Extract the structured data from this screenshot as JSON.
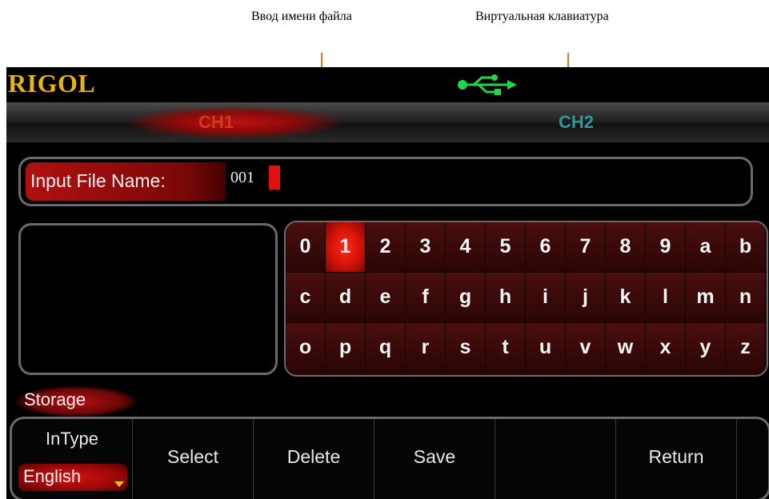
{
  "annotations": {
    "filename_input": "Ввод имени файла",
    "virtual_keyboard": "Виртуальная клавиатура"
  },
  "header": {
    "logo": "RIGOL",
    "usb_icon": "usb-icon",
    "colors": {
      "logo": "#e9b317",
      "usb": "#21d44a"
    }
  },
  "channels": {
    "ch1": "CH1",
    "ch2": "CH2",
    "active": "CH1"
  },
  "filename": {
    "label": "Input File Name:",
    "value": "001"
  },
  "keyboard": {
    "rows": [
      [
        "0",
        "1",
        "2",
        "3",
        "4",
        "5",
        "6",
        "7",
        "8",
        "9",
        "a",
        "b"
      ],
      [
        "c",
        "d",
        "e",
        "f",
        "g",
        "h",
        "i",
        "j",
        "k",
        "l",
        "m",
        "n"
      ],
      [
        "o",
        "p",
        "q",
        "r",
        "s",
        "t",
        "u",
        "v",
        "w",
        "x",
        "y",
        "z"
      ]
    ],
    "selected": "1"
  },
  "section_label": "Storage",
  "menu": {
    "intype_label": "InType",
    "intype_value": "English",
    "select": "Select",
    "delete": "Delete",
    "save": "Save",
    "empty": "",
    "return": "Return"
  }
}
